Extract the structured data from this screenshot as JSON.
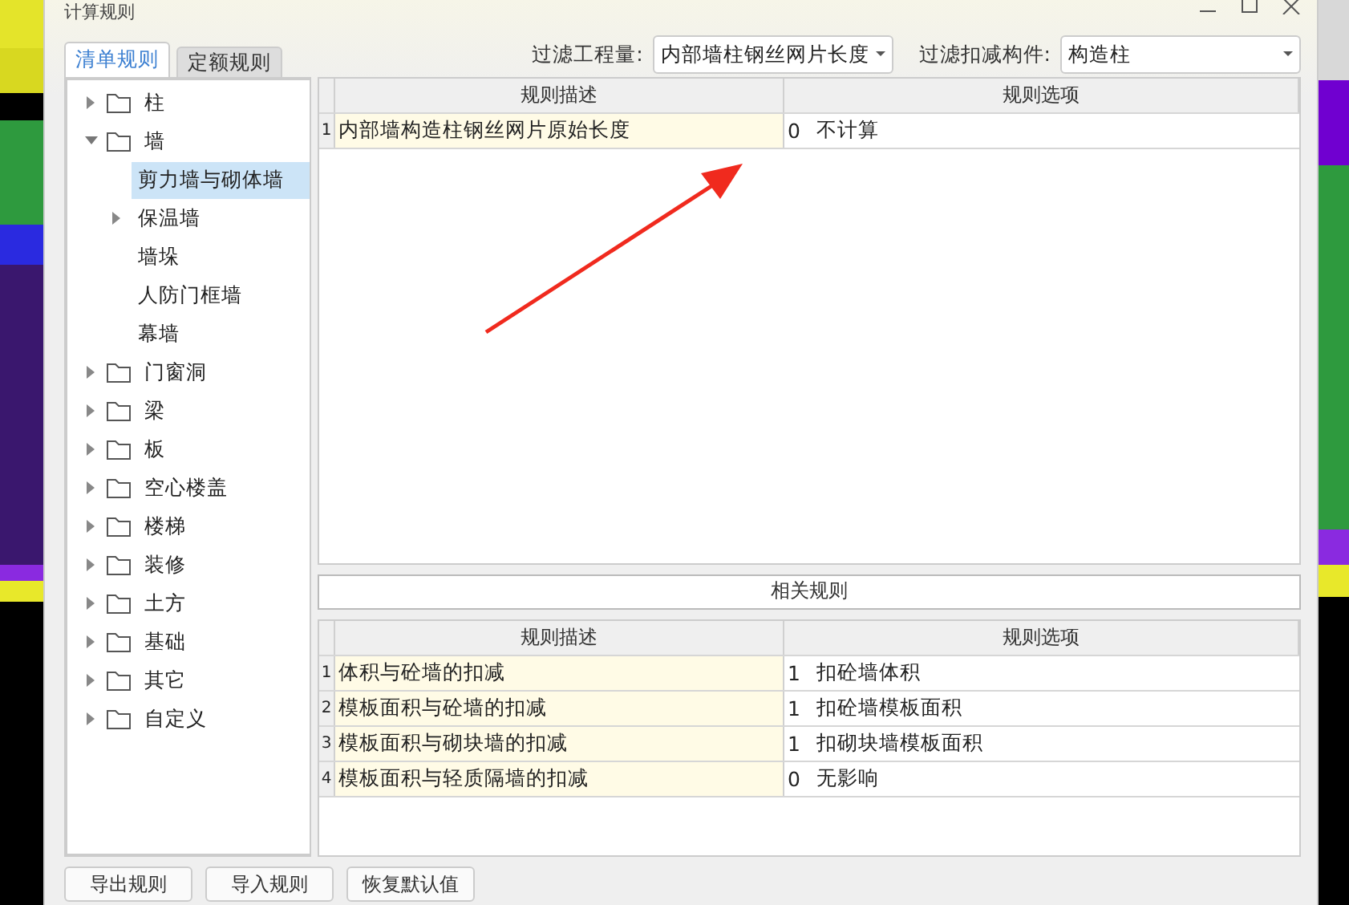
{
  "window": {
    "title": "计算规则"
  },
  "tabs": [
    {
      "label": "清单规则",
      "selected": true
    },
    {
      "label": "定额规则",
      "selected": false
    }
  ],
  "filters": [
    {
      "label": "过滤工程量:",
      "value": "内部墙柱钢丝网片长度"
    },
    {
      "label": "过滤扣减构件:",
      "value": "构造柱"
    }
  ],
  "tree": [
    {
      "label": "柱",
      "kind": "folder",
      "expanded": false
    },
    {
      "label": "墙",
      "kind": "folder",
      "expanded": true,
      "children": [
        {
          "label": "剪力墙与砌体墙",
          "selected": true
        },
        {
          "label": "保温墙",
          "selected": false,
          "expanded": false
        },
        {
          "label": "墙垛",
          "selected": false
        },
        {
          "label": "人防门框墙",
          "selected": false
        },
        {
          "label": "幕墙",
          "selected": false
        }
      ]
    },
    {
      "label": "门窗洞",
      "kind": "folder",
      "expanded": false
    },
    {
      "label": "梁",
      "kind": "folder",
      "expanded": false
    },
    {
      "label": "板",
      "kind": "folder",
      "expanded": false
    },
    {
      "label": "空心楼盖",
      "kind": "folder",
      "expanded": false
    },
    {
      "label": "楼梯",
      "kind": "folder",
      "expanded": false
    },
    {
      "label": "装修",
      "kind": "folder",
      "expanded": false
    },
    {
      "label": "土方",
      "kind": "folder",
      "expanded": false
    },
    {
      "label": "基础",
      "kind": "folder",
      "expanded": false
    },
    {
      "label": "其它",
      "kind": "folder",
      "expanded": false
    },
    {
      "label": "自定义",
      "kind": "folder",
      "expanded": false
    }
  ],
  "rules_table": {
    "columns": [
      "规则描述",
      "规则选项"
    ],
    "rows": [
      {
        "index": "1",
        "description": "内部墙构造柱钢丝网片原始长度",
        "option_code": "0",
        "option": "不计算"
      }
    ]
  },
  "related_rules": {
    "title": "相关规则",
    "columns": [
      "规则描述",
      "规则选项"
    ],
    "rows": [
      {
        "index": "1",
        "description": "体积与砼墙的扣减",
        "option_code": "1",
        "option": "扣砼墙体积"
      },
      {
        "index": "2",
        "description": "模板面积与砼墙的扣减",
        "option_code": "1",
        "option": "扣砼墙模板面积"
      },
      {
        "index": "3",
        "description": "模板面积与砌块墙的扣减",
        "option_code": "1",
        "option": "扣砌块墙模板面积"
      },
      {
        "index": "4",
        "description": "模板面积与轻质隔墙的扣减",
        "option_code": "0",
        "option": "无影响"
      }
    ]
  },
  "buttons": [
    "导出规则",
    "导入规则",
    "恢复默认值"
  ],
  "annotation": {
    "kind": "arrow"
  }
}
